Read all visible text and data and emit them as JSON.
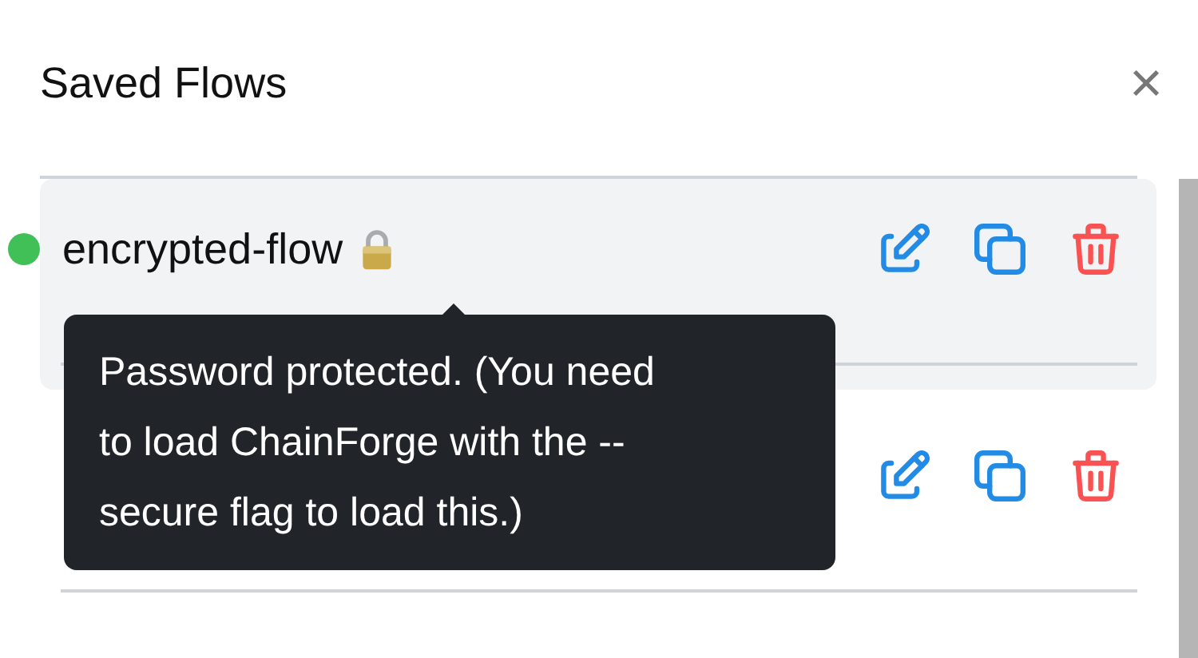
{
  "panel": {
    "title": "Saved Flows",
    "close": "×"
  },
  "flows": [
    {
      "name": "encrypted-flow",
      "selected": true,
      "active": true,
      "locked": true
    },
    {
      "selected": false,
      "active": false,
      "locked": false
    }
  ],
  "tooltip": {
    "text": "Password protected. (You need to load ChainForge with the --secure flag to load this.)"
  }
}
